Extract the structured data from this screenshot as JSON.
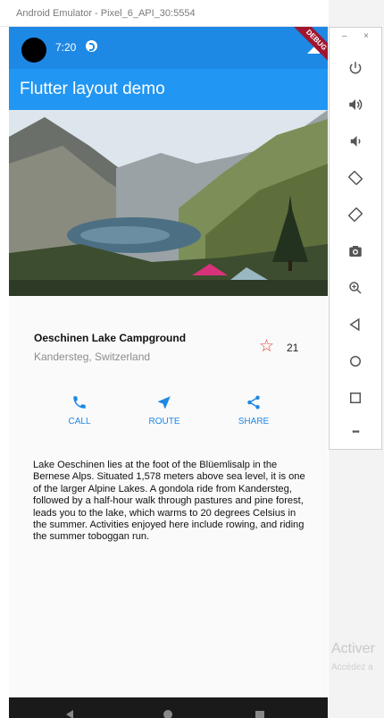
{
  "window": {
    "title": "Android Emulator - Pixel_6_API_30:5554"
  },
  "status_bar": {
    "time": "7:20",
    "debug_banner": "DEBUG"
  },
  "app_bar": {
    "title": "Flutter layout demo"
  },
  "place": {
    "name": "Oeschinen Lake Campground",
    "location": "Kandersteg, Switzerland",
    "favorite_count": "21"
  },
  "actions": {
    "call": "CALL",
    "route": "ROUTE",
    "share": "SHARE"
  },
  "description": "Lake Oeschinen lies at the foot of the Blüemlisalp in the Bernese Alps. Situated 1,578 meters above sea level, it is one of the larger Alpine Lakes. A gondola ride from Kandersteg, followed by a half-hour walk through pastures and pine forest, leads you to the lake, which warms to 20 degrees Celsius in the summer. Activities enjoyed here include rowing, and riding the summer toboggan run.",
  "emulator_controls": {
    "minimize": "–",
    "close": "×",
    "more": "•••"
  },
  "windows_overlay": {
    "activate": "Activer",
    "access": "Accédez a"
  },
  "colors": {
    "app_bar": "#2196f3",
    "status_bar": "#1e88e5",
    "accent": "#1e88e5",
    "star": "#e53935"
  }
}
